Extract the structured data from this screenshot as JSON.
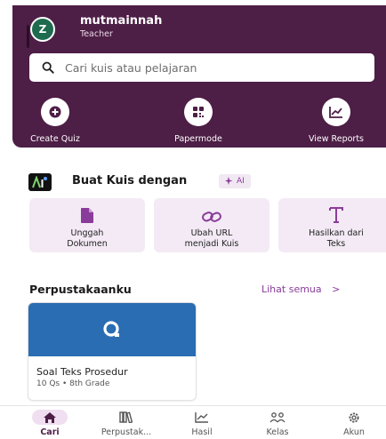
{
  "header": {
    "avatar_initial": "Z",
    "user_name": "mutmainnah",
    "user_role": "Teacher"
  },
  "search": {
    "placeholder": "Cari kuis atau pelajaran"
  },
  "quick_actions": [
    {
      "label": "Create Quiz",
      "icon": "plus-circle-icon"
    },
    {
      "label": "Papermode",
      "icon": "qr-code-icon"
    },
    {
      "label": "View Reports",
      "icon": "chart-line-icon"
    }
  ],
  "ai_section": {
    "title": "Buat Kuis dengan",
    "badge": "AI",
    "cards": [
      {
        "line1": "Unggah",
        "line2": "Dokumen",
        "icon": "document-icon"
      },
      {
        "line1": "Ubah URL",
        "line2": "menjadi Kuis",
        "icon": "link-icon"
      },
      {
        "line1": "Hasilkan dari",
        "line2": "Teks",
        "icon": "text-icon"
      }
    ]
  },
  "library": {
    "title": "Perpustakaanku",
    "see_all": "Lihat semua",
    "quiz": {
      "name": "Soal Teks Prosedur",
      "meta": "10 Qs • 8th Grade"
    }
  },
  "bottom_nav": [
    {
      "label": "Cari",
      "icon": "home-icon",
      "active": true
    },
    {
      "label": "Perpustak...",
      "icon": "library-icon",
      "active": false
    },
    {
      "label": "Hasil",
      "icon": "chart-line-icon",
      "active": false
    },
    {
      "label": "Kelas",
      "icon": "people-icon",
      "active": false
    },
    {
      "label": "Akun",
      "icon": "gear-icon",
      "active": false
    }
  ],
  "colors": {
    "header_bg": "#4d1e46",
    "accent": "#8a3c9a",
    "card_bg": "#f3eaf5",
    "quiz_thumb": "#2a6db3"
  }
}
